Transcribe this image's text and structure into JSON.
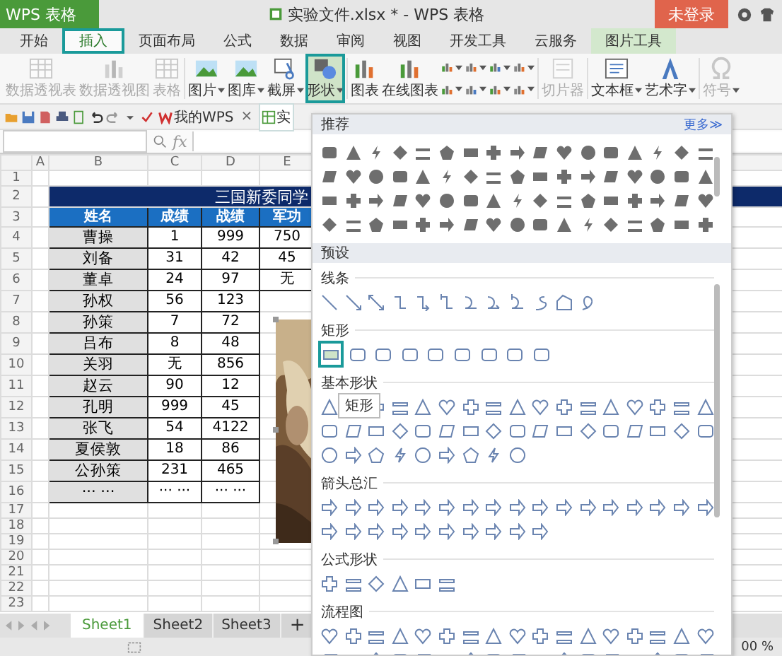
{
  "title_bar": {
    "app_button": "WPS 表格",
    "title": "实验文件.xlsx * - WPS 表格",
    "login_button": "未登录"
  },
  "tabs": [
    {
      "label": "开始",
      "selected": false,
      "kind": "normal"
    },
    {
      "label": "插入",
      "selected": true,
      "kind": "normal"
    },
    {
      "label": "页面布局",
      "selected": false,
      "kind": "normal"
    },
    {
      "label": "公式",
      "selected": false,
      "kind": "normal"
    },
    {
      "label": "数据",
      "selected": false,
      "kind": "normal"
    },
    {
      "label": "审阅",
      "selected": false,
      "kind": "normal"
    },
    {
      "label": "视图",
      "selected": false,
      "kind": "normal"
    },
    {
      "label": "开发工具",
      "selected": false,
      "kind": "normal"
    },
    {
      "label": "云服务",
      "selected": false,
      "kind": "normal"
    },
    {
      "label": "图片工具",
      "selected": false,
      "kind": "context"
    }
  ],
  "ribbon": [
    {
      "kind": "large",
      "label": "数据透视表",
      "disabled": true,
      "dropdown": false,
      "selected": false
    },
    {
      "kind": "large",
      "label": "数据透视图",
      "disabled": true,
      "dropdown": false,
      "selected": false
    },
    {
      "kind": "large",
      "label": "表格",
      "disabled": true,
      "dropdown": false,
      "selected": false
    },
    {
      "kind": "separator"
    },
    {
      "kind": "large",
      "label": "图片",
      "disabled": false,
      "dropdown": true,
      "selected": false
    },
    {
      "kind": "large",
      "label": "图库",
      "disabled": false,
      "dropdown": true,
      "selected": false
    },
    {
      "kind": "large",
      "label": "截屏",
      "disabled": false,
      "dropdown": true,
      "selected": false
    },
    {
      "kind": "large",
      "label": "形状",
      "disabled": false,
      "dropdown": true,
      "selected": true
    },
    {
      "kind": "separator"
    },
    {
      "kind": "large",
      "label": "图表",
      "disabled": false,
      "dropdown": false,
      "selected": false
    },
    {
      "kind": "large",
      "label": "在线图表",
      "disabled": false,
      "dropdown": false,
      "selected": false
    },
    {
      "kind": "mini"
    },
    {
      "kind": "separator"
    },
    {
      "kind": "large",
      "label": "切片器",
      "disabled": true,
      "dropdown": false,
      "selected": false
    },
    {
      "kind": "separator"
    },
    {
      "kind": "large",
      "label": "文本框",
      "disabled": false,
      "dropdown": true,
      "selected": false
    },
    {
      "kind": "large",
      "label": "艺术字",
      "disabled": false,
      "dropdown": true,
      "selected": false
    },
    {
      "kind": "separator"
    },
    {
      "kind": "large",
      "label": "符号",
      "disabled": true,
      "dropdown": true,
      "selected": false
    }
  ],
  "doc_tabs": [
    {
      "label": "我的WPS",
      "close": "×"
    },
    {
      "label": "实"
    }
  ],
  "formula_bar": {
    "fx": "fx"
  },
  "sheet": {
    "columns": [
      "A",
      "B",
      "C",
      "D",
      "E"
    ],
    "rows": [
      {
        "num": "1",
        "kind": "blank"
      },
      {
        "num": "2",
        "kind": "title",
        "title": "三国新委同学"
      },
      {
        "num": "3",
        "kind": "header",
        "cells": [
          "姓名",
          "成绩",
          "战绩",
          "军功"
        ]
      },
      {
        "num": "4",
        "kind": "data",
        "cells": [
          "曹操",
          "1",
          "999",
          "750"
        ]
      },
      {
        "num": "5",
        "kind": "data",
        "cells": [
          "刘备",
          "31",
          "42",
          "45"
        ]
      },
      {
        "num": "6",
        "kind": "data",
        "cells": [
          "董卓",
          "24",
          "97",
          "无"
        ]
      },
      {
        "num": "7",
        "kind": "data",
        "cells": [
          "孙权",
          "56",
          "123"
        ]
      },
      {
        "num": "8",
        "kind": "data",
        "cells": [
          "孙策",
          "7",
          "72"
        ]
      },
      {
        "num": "9",
        "kind": "data",
        "cells": [
          "吕布",
          "8",
          "48"
        ]
      },
      {
        "num": "10",
        "kind": "data",
        "cells": [
          "关羽",
          "无",
          "856"
        ]
      },
      {
        "num": "11",
        "kind": "data",
        "cells": [
          "赵云",
          "90",
          "12"
        ]
      },
      {
        "num": "12",
        "kind": "data",
        "cells": [
          "孔明",
          "999",
          "45"
        ]
      },
      {
        "num": "13",
        "kind": "data",
        "cells": [
          "张飞",
          "54",
          "4122"
        ]
      },
      {
        "num": "14",
        "kind": "data",
        "cells": [
          "夏侯敦",
          "18",
          "86"
        ]
      },
      {
        "num": "15",
        "kind": "data",
        "cells": [
          "公孙策",
          "231",
          "465"
        ]
      },
      {
        "num": "16",
        "kind": "data",
        "cells": [
          "··· ···",
          "··· ···",
          "··· ···"
        ]
      },
      {
        "num": "17",
        "kind": "blank"
      },
      {
        "num": "18",
        "kind": "blank"
      },
      {
        "num": "19",
        "kind": "blank"
      },
      {
        "num": "20",
        "kind": "blank"
      },
      {
        "num": "21",
        "kind": "blank"
      },
      {
        "num": "22",
        "kind": "blank"
      },
      {
        "num": "23",
        "kind": "blank"
      }
    ]
  },
  "sheet_tabs": [
    {
      "label": "Sheet1",
      "selected": true
    },
    {
      "label": "Sheet2",
      "selected": false
    },
    {
      "label": "Sheet3",
      "selected": false
    }
  ],
  "add_sheet": "+",
  "status_bar": {
    "zoom": "00 %"
  },
  "shape_menu": {
    "recommended": "推荐",
    "more": "更多≫",
    "presets": "预设",
    "sections": [
      {
        "title": "线条"
      },
      {
        "title": "矩形",
        "items": [
          {
            "selected": true
          },
          {
            "selected": false
          },
          {
            "selected": false
          },
          {
            "selected": false
          },
          {
            "selected": false
          },
          {
            "selected": false
          },
          {
            "selected": false
          },
          {
            "selected": false
          },
          {
            "selected": false
          }
        ]
      },
      {
        "title": "基本形状"
      },
      {
        "title": "箭头总汇"
      },
      {
        "title": "公式形状"
      },
      {
        "title": "流程图"
      }
    ],
    "tooltip": "矩形"
  }
}
